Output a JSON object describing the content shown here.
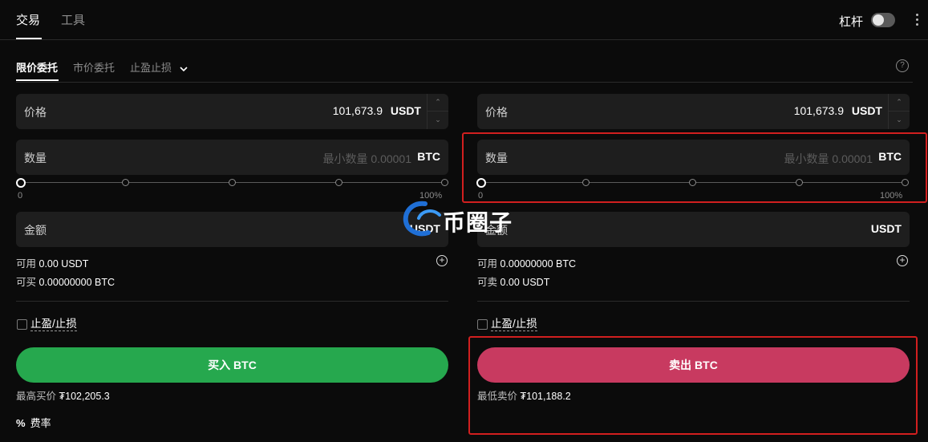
{
  "top_tabs": [
    {
      "label": "交易"
    },
    {
      "label": "工具"
    }
  ],
  "leverage": {
    "label": "杠杆",
    "enabled": false
  },
  "order_tabs": [
    {
      "label": "限价委托"
    },
    {
      "label": "市价委托"
    },
    {
      "label": "止盈止损"
    }
  ],
  "help_icon": "?",
  "buy": {
    "price": {
      "label": "价格",
      "value": "101,673.9",
      "unit": "USDT"
    },
    "amount": {
      "label": "数量",
      "placeholder": "最小数量 0.00001",
      "unit": "BTC"
    },
    "slider": {
      "min_label": "0",
      "max_label": "100%",
      "percent": 0
    },
    "total": {
      "label": "金额",
      "unit": "USDT"
    },
    "available_label": "可用",
    "available_value": "0.00 USDT",
    "can_trade_label": "可买",
    "can_trade_value": "0.00000000 BTC",
    "tpsl_label": "止盈/止损",
    "button_label": "买入 BTC",
    "best_price_label": "最高买价",
    "best_price_value": "₮102,205.3"
  },
  "sell": {
    "price": {
      "label": "价格",
      "value": "101,673.9",
      "unit": "USDT"
    },
    "amount": {
      "label": "数量",
      "placeholder": "最小数量 0.00001",
      "unit": "BTC"
    },
    "slider": {
      "min_label": "0",
      "max_label": "100%",
      "percent": 0
    },
    "total": {
      "label": "金额",
      "unit": "USDT"
    },
    "available_label": "可用",
    "available_value": "0.00000000 BTC",
    "can_trade_label": "可卖",
    "can_trade_value": "0.00 USDT",
    "tpsl_label": "止盈/止损",
    "button_label": "卖出 BTC",
    "best_price_label": "最低卖价",
    "best_price_value": "₮101,188.2"
  },
  "fee": {
    "icon": "%",
    "label": "费率"
  },
  "watermark": {
    "text": "币圈子"
  },
  "colors": {
    "buy": "#26a84e",
    "sell": "#c83a60",
    "highlight": "#d11f1f",
    "background": "#0b0b0b",
    "field": "#1e1e1e"
  }
}
